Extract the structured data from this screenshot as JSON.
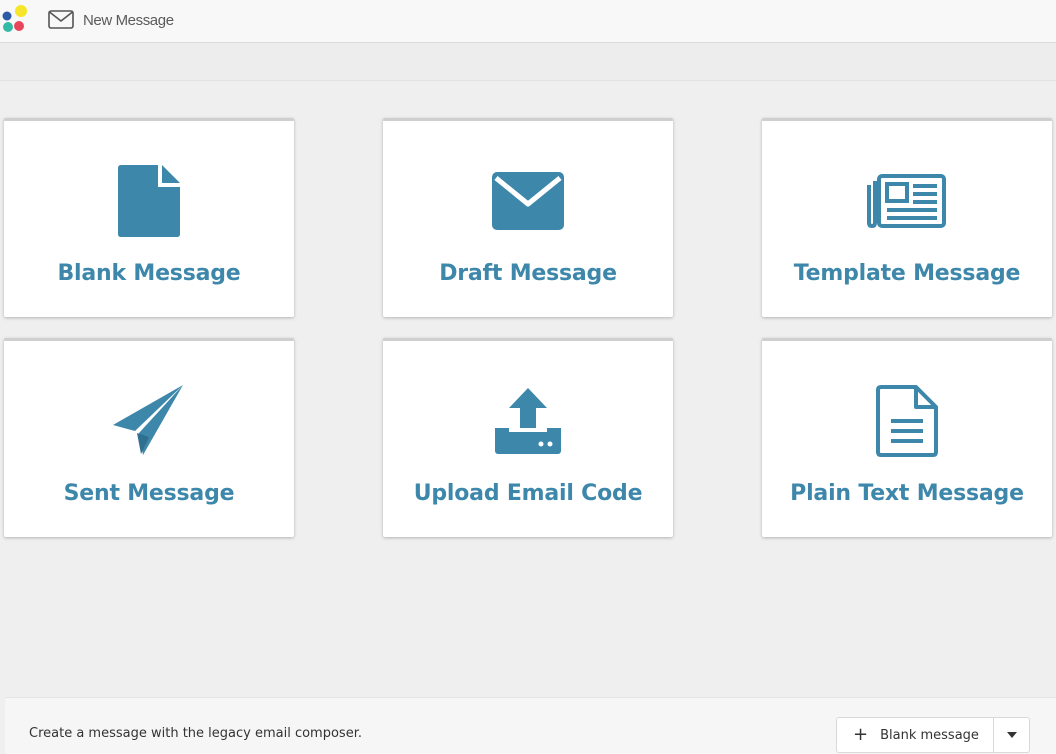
{
  "app": {
    "title": "New Message"
  },
  "colors": {
    "accent": "#3d87ab",
    "background": "#efefef",
    "card": "#ffffff"
  },
  "cards": [
    {
      "label": "Blank Message",
      "icon": "document-icon"
    },
    {
      "label": "Draft Message",
      "icon": "envelope-icon"
    },
    {
      "label": "Template Message",
      "icon": "newspaper-icon"
    },
    {
      "label": "Sent Message",
      "icon": "paper-plane-icon"
    },
    {
      "label": "Upload Email Code",
      "icon": "upload-icon"
    },
    {
      "label": "Plain Text Message",
      "icon": "text-file-icon"
    }
  ],
  "footer": {
    "description": "Create a message with the legacy email composer.",
    "button_label": "Blank message",
    "button_icon": "plus-icon",
    "dropdown_icon": "caret-down-icon"
  }
}
